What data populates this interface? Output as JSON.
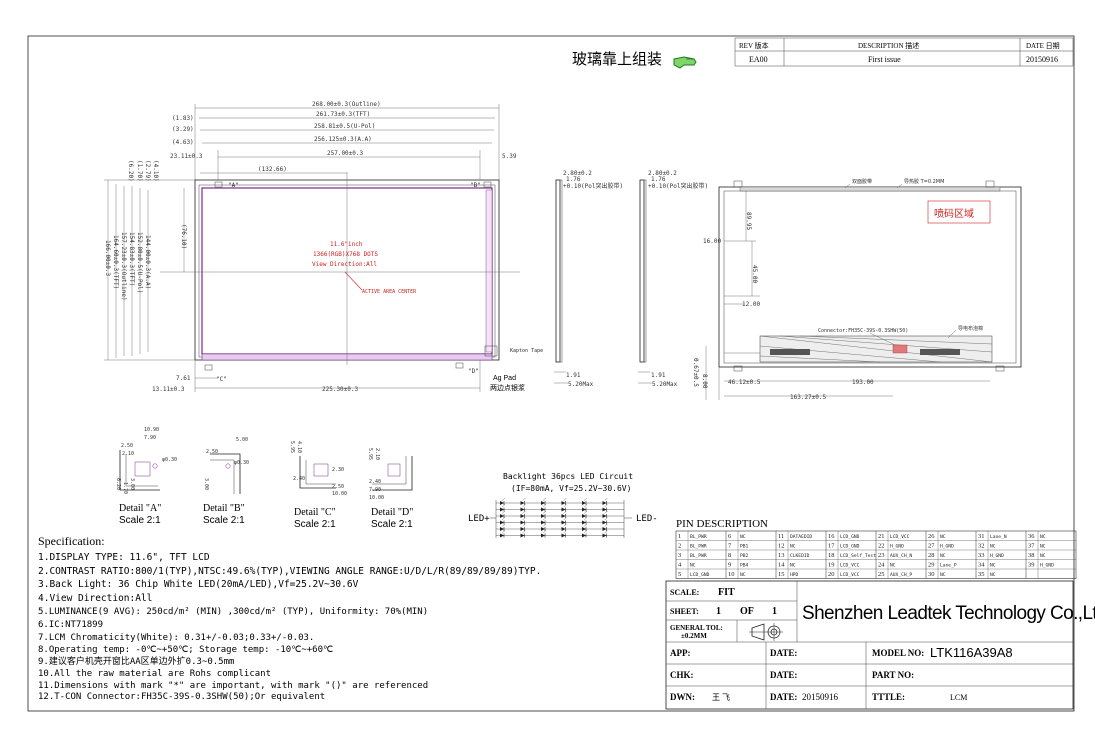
{
  "header": {
    "assembly_note_cn": "玻璃靠上组装",
    "rev_table": {
      "headers": [
        "REV 版本",
        "DESCRIPTION 描述",
        "DATE 日期"
      ],
      "rows": [
        [
          "EA00",
          "First issue",
          "20150916"
        ]
      ]
    }
  },
  "front_view": {
    "dims_top": [
      "268.00±0.3(Outline)",
      "261.73±0.3(TFT)",
      "258.81±0.5(U-Pol)",
      "256.125±0.3(A.A)",
      "257.00±0.3"
    ],
    "dims_top_left": [
      "(1.83)",
      "(3.29)",
      "(4.63)",
      "23.11±0.3"
    ],
    "dim_right_top": "5.39",
    "dim_inner": "(132.66)",
    "dims_left_vertical": [
      "(6.20)",
      "(1.70)",
      "(2.79)",
      "(4.10)",
      "166.00±0.3",
      "164.60±0.3(TFT)",
      "157.23±0.3(Outline)",
      "154.83±0.3(TFT)",
      "152.80±0.5(U-Pol)",
      "144.00±0.3(A.A)"
    ],
    "dim_center_vertical": "(76.10)",
    "center_text": [
      "11.6\"inch",
      "1366(RGB)X768 DOTS",
      "View Direction:All"
    ],
    "active_area_label": "ACTIVE AREA CENTER",
    "corner_labels": [
      "\"A\"",
      "\"B\"",
      "\"C\"",
      "\"D\""
    ],
    "dims_bottom": [
      "7.61",
      "13.11±0.3",
      "225.30±0.3"
    ],
    "ag_pad": "Ag Pad",
    "ag_pad_cn": "两边点银浆",
    "kapton_label": "Kapton Tape"
  },
  "side_views": [
    {
      "dims": [
        "2.80±0.2",
        "1.76",
        "+0.10(Pol突出胶带)"
      ],
      "bottom": [
        "1.91",
        "5.20Max"
      ]
    },
    {
      "dims": [
        "2.80±0.2",
        "1.76",
        "+0.10(Pol突出胶带)"
      ],
      "bottom": [
        "1.91",
        "5.20Max"
      ]
    }
  ],
  "back_view": {
    "top_labels": [
      "双面胶带",
      "导热胶 T=0.2MM"
    ],
    "code_area_cn": "喷码区域",
    "dims": [
      "16.00",
      "89.95",
      "45.00",
      "12.00",
      "46.12±0.5",
      "193.00",
      "163.27±0.5",
      "8.00"
    ],
    "connector_label": "Connector:FH35C-39S-0.3SHW(50)",
    "foam_label": "导电布泡棉",
    "left_vertical": "0.67±0.5"
  },
  "details": [
    {
      "title": "Detail \"A\"",
      "scale": "Scale 2:1",
      "dims": [
        "10.90",
        "7.90",
        "2.50",
        "2.10",
        "φ0.30",
        "6.20",
        "1.70",
        "3.00"
      ]
    },
    {
      "title": "Detail \"B\"",
      "scale": "Scale 2:1",
      "dims": [
        "5.00",
        "2.50",
        "φ0.30",
        "3.00"
      ]
    },
    {
      "title": "Detail \"C\"",
      "scale": "Scale 2:1",
      "dims": [
        "5.95",
        "4.10",
        "2.30",
        "2.40",
        "2.50",
        "10.00"
      ]
    },
    {
      "title": "Detail \"D\"",
      "scale": "Scale 2:1",
      "dims": [
        "5.95",
        "2.10",
        "2.40",
        "7.90",
        "10.00"
      ]
    }
  ],
  "backlight": {
    "title": "Backlight 36pcs LED Circuit",
    "subtitle": "(IF=80mA, Vf=25.2V~30.6V)",
    "led_plus": "LED+",
    "led_minus": "LED-",
    "rows": 6,
    "cols": 6
  },
  "spec": {
    "title": "Specification:",
    "lines": [
      "1.DISPLAY TYPE: 11.6\", TFT LCD",
      "2.CONTRAST RATIO:800/1(TYP),NTSC:49.6%(TYP),VIEWING ANGLE RANGE:U/D/L/R(89/89/89/89)TYP.",
      "3.Back Light: 36 Chip White LED(20mA/LED),Vf=25.2V~30.6V",
      "4.View Direction:All",
      "5.LUMINANCE(9 AVG): 250cd/m² (MIN) ,300cd/m² (TYP), Uniformity: 70%(MIN)",
      "6.IC:NT71899",
      "7.LCM Chromaticity(White): 0.31+/-0.03;0.33+/-0.03.",
      "8.Operating temp: -0℃~+50℃; Storage temp: -10℃~+60℃",
      "9.建议客户机壳开窗比AA区单边外扩0.3~0.5mm",
      "10.All the raw material are Rohs  complicant",
      "11.Dimensions with mark \"*\" are important, with mark \"()\" are referenced",
      "12.T-CON Connector:FH35C-39S-0.3SHW(50);Or equivalent"
    ]
  },
  "pin_table": {
    "title": "PIN DESCRIPTION",
    "rows": [
      [
        [
          "1",
          "BL_PWR"
        ],
        [
          "6",
          "NC"
        ],
        [
          "11",
          "DATAEDID"
        ],
        [
          "16",
          "LCD_GND"
        ],
        [
          "21",
          "LCD_VCC"
        ],
        [
          "26",
          "NC"
        ],
        [
          "31",
          "Lane_N"
        ],
        [
          "36",
          "NC"
        ]
      ],
      [
        [
          "2",
          "BL_PWR"
        ],
        [
          "7",
          "PB1"
        ],
        [
          "12",
          "NC"
        ],
        [
          "17",
          "LCD_GND"
        ],
        [
          "22",
          "H_GND"
        ],
        [
          "27",
          "H_GND"
        ],
        [
          "32",
          "NC"
        ],
        [
          "37",
          "NC"
        ]
      ],
      [
        [
          "3",
          "BL_PWR"
        ],
        [
          "8",
          "PB2"
        ],
        [
          "13",
          "CLKEDID"
        ],
        [
          "18",
          "LCD_Self_Test"
        ],
        [
          "23",
          "AUX_CH_N"
        ],
        [
          "28",
          "NC"
        ],
        [
          "33",
          "H_GND"
        ],
        [
          "38",
          "NC"
        ]
      ],
      [
        [
          "4",
          "NC"
        ],
        [
          "9",
          "PB4"
        ],
        [
          "14",
          "NC"
        ],
        [
          "19",
          "LCD_VCC"
        ],
        [
          "24",
          "NC"
        ],
        [
          "29",
          "Lane_P"
        ],
        [
          "34",
          "NC"
        ],
        [
          "39",
          "H_GND"
        ]
      ],
      [
        [
          "5",
          "LCD_GND"
        ],
        [
          "10",
          "NC"
        ],
        [
          "15",
          "HPD"
        ],
        [
          "20",
          "LCD_VCC"
        ],
        [
          "25",
          "AUX_CH_P"
        ],
        [
          "30",
          "NC"
        ],
        [
          "35",
          "NC"
        ],
        [
          "",
          ""
        ]
      ]
    ]
  },
  "title_block": {
    "scale_label": "SCALE:",
    "scale_value": "FIT",
    "sheet_label": "SHEET:",
    "sheet_value": "1",
    "sheet_of": "OF",
    "sheet_total": "1",
    "tol_label": "GENERAL TOL:",
    "tol_value": "±0.2MM",
    "company": "Shenzhen Leadtek Technology Co.,Ltd",
    "app_label": "APP:",
    "chk_label": "CHK:",
    "dwn_label": "DWN:",
    "dwn_value": "王 飞",
    "date_label": "DATE:",
    "date_value": "20150916",
    "model_label": "MODEL NO:",
    "model_value": "LTK116A39A8",
    "part_label": "PART NO:",
    "title_label": "TTTLE:",
    "title_value": "LCM"
  }
}
